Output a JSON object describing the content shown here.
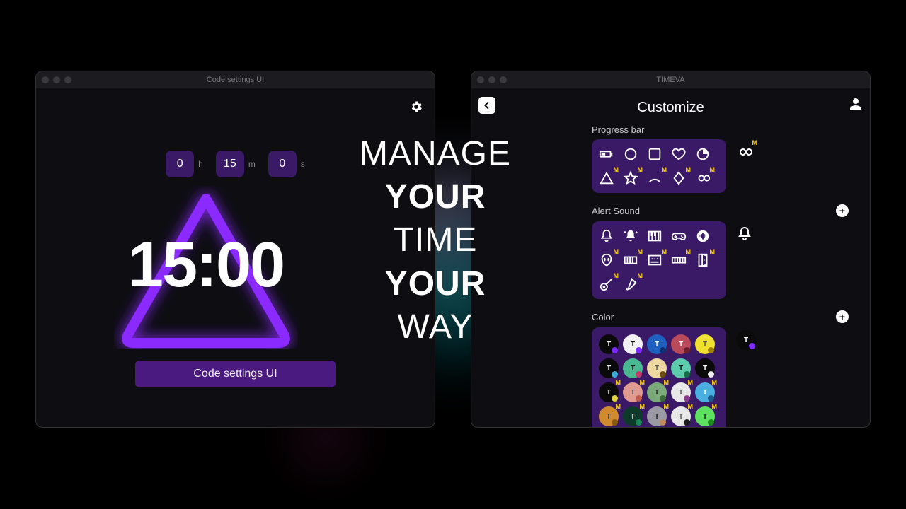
{
  "window_left": {
    "title": "Code settings UI",
    "time_inputs": {
      "h": "0",
      "m": "15",
      "s": "0",
      "h_unit": "h",
      "m_unit": "m",
      "s_unit": "s"
    },
    "big_time": "15:00",
    "action_label": "Code settings UI",
    "accent_color": "#7a2aff"
  },
  "window_right": {
    "title": "TIMEVA",
    "page_title": "Customize",
    "sections": {
      "progress": {
        "label": "Progress bar",
        "options": [
          {
            "name": "battery-icon",
            "m": false
          },
          {
            "name": "circle-icon",
            "m": false
          },
          {
            "name": "square-icon",
            "m": false
          },
          {
            "name": "heart-icon",
            "m": false
          },
          {
            "name": "pie-icon",
            "m": false
          },
          {
            "name": "triangle-icon",
            "m": true
          },
          {
            "name": "star-icon",
            "m": true
          },
          {
            "name": "arc-icon",
            "m": true
          },
          {
            "name": "diamond-icon",
            "m": true
          },
          {
            "name": "infinity-icon",
            "m": true
          }
        ],
        "aux": {
          "name": "infinity-icon",
          "m": true
        }
      },
      "alert": {
        "label": "Alert Sound",
        "options": [
          {
            "name": "bell-icon",
            "m": false
          },
          {
            "name": "bell-ring-icon",
            "m": false
          },
          {
            "name": "piano-icon",
            "m": false
          },
          {
            "name": "gamepad-icon",
            "m": false
          },
          {
            "name": "audio-wave-icon",
            "m": false
          },
          {
            "name": "alien-icon",
            "m": true
          },
          {
            "name": "synth-icon",
            "m": true
          },
          {
            "name": "mixer-icon",
            "m": true
          },
          {
            "name": "keyboard-icon",
            "m": true
          },
          {
            "name": "door-icon",
            "m": true
          },
          {
            "name": "guitar-icon",
            "m": true
          },
          {
            "name": "brush-icon",
            "m": true
          }
        ],
        "aux": {
          "name": "bell-outline-icon"
        }
      },
      "color": {
        "label": "Color",
        "swatches": [
          {
            "bg": "#0a0a0a",
            "dot": "#7a2aff",
            "t": "#fff",
            "m": false
          },
          {
            "bg": "#f0f0f0",
            "dot": "#7a2aff",
            "t": "#111",
            "m": false
          },
          {
            "bg": "#1e5fbf",
            "dot": "#103070",
            "t": "#fff",
            "m": false
          },
          {
            "bg": "#b84a5a",
            "dot": "#6a2030",
            "t": "#fff",
            "m": false
          },
          {
            "bg": "#f0e030",
            "dot": "#a08000",
            "t": "#555",
            "m": false
          },
          {
            "bg": "#0a0a0a",
            "dot": "#3aaad8",
            "t": "#fff",
            "m": false
          },
          {
            "bg": "#4ab890",
            "dot": "#c03a6a",
            "t": "#111",
            "m": false
          },
          {
            "bg": "#ecd8a0",
            "dot": "#6a4a10",
            "t": "#555",
            "m": false
          },
          {
            "bg": "#5cccac",
            "dot": "#1a6a4a",
            "t": "#111",
            "m": false
          },
          {
            "bg": "#0a0a0a",
            "dot": "#f0f0f0",
            "t": "#fff",
            "m": false
          },
          {
            "bg": "#0a0a0a",
            "dot": "#e0d040",
            "t": "#fff",
            "m": true
          },
          {
            "bg": "#e09a90",
            "dot": "#c05a4a",
            "t": "#555",
            "m": true
          },
          {
            "bg": "#7aaa7a",
            "dot": "#3a6a3a",
            "t": "#222",
            "m": true
          },
          {
            "bg": "#e8e8e8",
            "dot": "#8a3a8a",
            "t": "#555",
            "m": true
          },
          {
            "bg": "#4aaee0",
            "dot": "#1a5a8a",
            "t": "#fff",
            "m": true
          },
          {
            "bg": "#d08a30",
            "dot": "#8a5a10",
            "t": "#222",
            "m": true
          },
          {
            "bg": "#0d3a2a",
            "dot": "#1a8a5a",
            "t": "#fff",
            "m": true
          },
          {
            "bg": "#9a9aa4",
            "dot": "#c08a5a",
            "t": "#222",
            "m": true
          },
          {
            "bg": "#e8e8e8",
            "dot": "#1a1a1a",
            "t": "#555",
            "m": true
          },
          {
            "bg": "#5ee060",
            "dot": "#1a8a1a",
            "t": "#222",
            "m": true
          }
        ],
        "aux": {
          "bg": "#0a0a0a",
          "dot": "#7a2aff",
          "t": "#fff"
        }
      }
    }
  },
  "hero": {
    "l1": "MANAGE",
    "l2": "YOUR",
    "l3": "TIME",
    "l4": "YOUR",
    "l5": "WAY"
  },
  "badge_text": "M",
  "swatch_letter": "T"
}
